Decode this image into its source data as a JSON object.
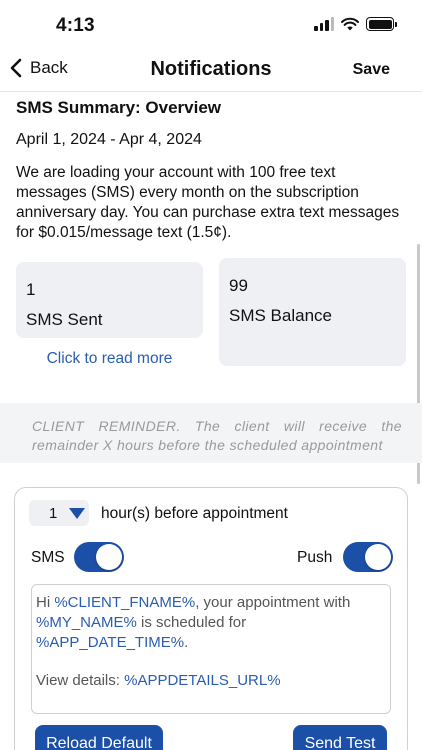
{
  "status_bar": {
    "time": "4:13"
  },
  "nav": {
    "back_label": "Back",
    "title": "Notifications",
    "save_label": "Save"
  },
  "summary": {
    "heading": "SMS Summary: Overview",
    "date_range": "April 1, 2024 - Apr 4, 2024",
    "description": "We are loading your account with 100 free text messages (SMS) every month on the subscription anniversary day. You can purchase extra text messages for $0.015/message text (1.5¢).",
    "sent": {
      "value": "1",
      "label": "SMS Sent"
    },
    "balance": {
      "value": "99",
      "label": "SMS Balance"
    },
    "read_more": "Click to read more"
  },
  "reminder": {
    "note": "CLIENT REMINDER. The client will receive the remainder X hours before the scheduled appointment",
    "hours_value": "1",
    "hours_label": "hour(s) before appointment",
    "sms_label": "SMS",
    "sms_enabled": true,
    "push_label": "Push",
    "push_enabled": true,
    "message": {
      "t1": "Hi ",
      "v1": "%CLIENT_FNAME%",
      "t2": ", your appointment with ",
      "v2": "%MY_NAME%",
      "t3": " is scheduled for ",
      "v3": "%APP_DATE_TIME%",
      "t4": ".",
      "t5": "View details: ",
      "v4": "%APPDETAILS_URL%"
    },
    "reload_label": "Reload Default",
    "send_test_label": "Send Test"
  },
  "colors": {
    "accent": "#1b4fa8",
    "link": "#2a5db0",
    "card_bg": "#eef0f4"
  }
}
